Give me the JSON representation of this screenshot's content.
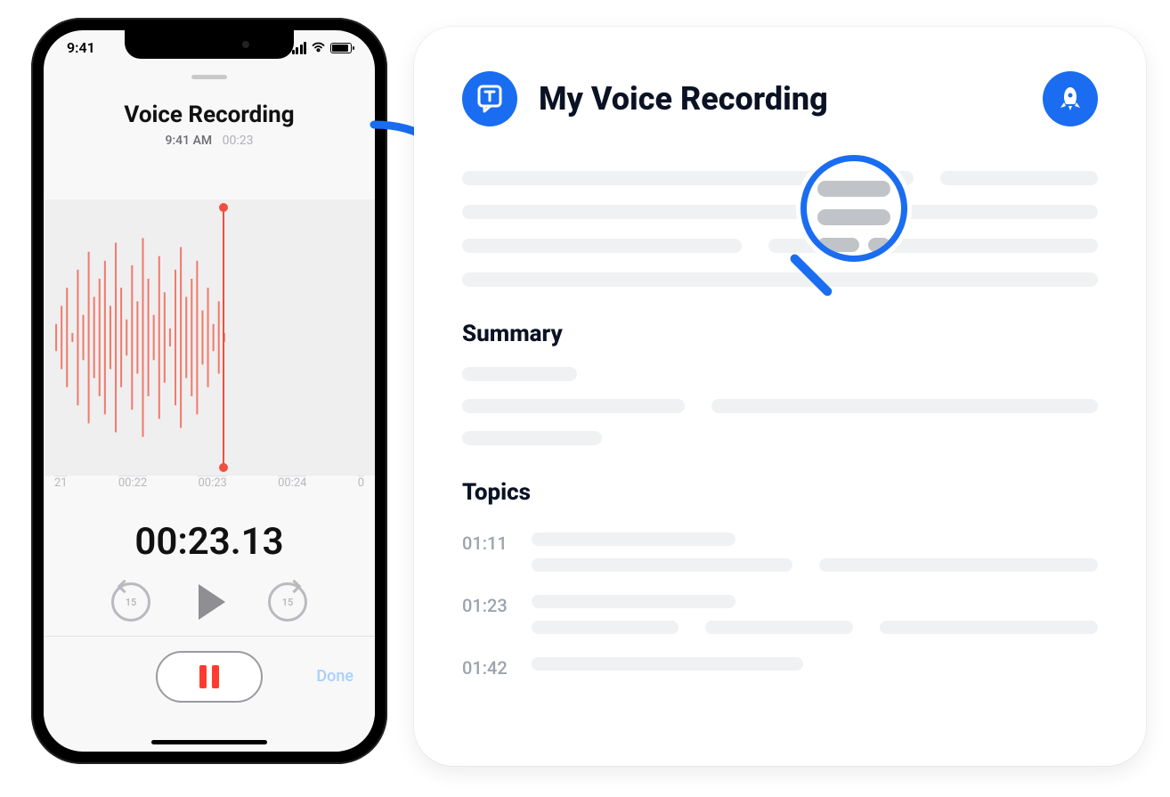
{
  "phone": {
    "status_time": "9:41",
    "title": "Voice Recording",
    "subtitle_time": "9:41 AM",
    "subtitle_duration": "00:23",
    "ruler": {
      "t0": "21",
      "t1": "00:22",
      "t2": "00:23",
      "t3": "00:24",
      "t4": "0"
    },
    "big_time": "00:23.13",
    "skip_label": "15",
    "done_label": "Done"
  },
  "card": {
    "title": "My Voice Recording",
    "summary_heading": "Summary",
    "topics_heading": "Topics",
    "topic_times": [
      "01:11",
      "01:23",
      "01:42"
    ]
  },
  "colors": {
    "accent": "#1a6df0",
    "recording": "#ff3b30"
  }
}
